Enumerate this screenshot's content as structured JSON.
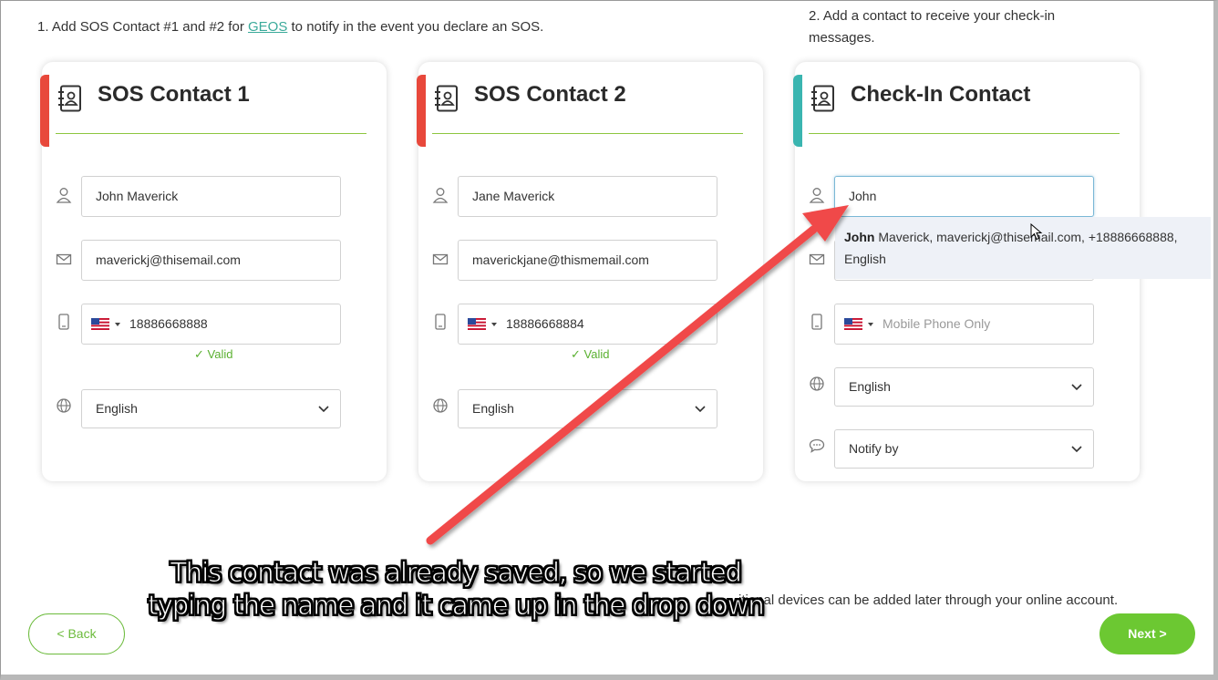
{
  "step1": {
    "before": "1. Add SOS Contact #1 and #2 for ",
    "link": "GEOS",
    "after": " to notify in the event you declare an SOS."
  },
  "step2": {
    "text": "2. Add a contact to receive your check-in messages."
  },
  "colors": {
    "sos_accent": "#e8483b",
    "checkin_accent": "#3ab5b0",
    "rule": "#8dc63f",
    "brand_green": "#6cc832",
    "valid": "#5ab030"
  },
  "sos1": {
    "title": "SOS Contact 1",
    "name": "John Maverick",
    "email": "maverickj@thisemail.com",
    "phone": "18886668888",
    "valid": "✓ Valid",
    "language": "English"
  },
  "sos2": {
    "title": "SOS Contact 2",
    "name": "Jane Maverick",
    "email": "maverickjane@thismemail.com",
    "phone": "18886668884",
    "valid": "✓ Valid",
    "language": "English"
  },
  "checkin": {
    "title": "Check-In Contact",
    "name": "John",
    "phone_placeholder": "Mobile Phone Only",
    "language": "English",
    "notify": "Notify by"
  },
  "suggestion": {
    "match": "John",
    "rest": " Maverick, maverickj@thisemail.com, +18886668888,",
    "line2": "English"
  },
  "footer": {
    "text": "itional devices can be added later through your online account."
  },
  "buttons": {
    "back": "< Back",
    "next": "Next >"
  },
  "annotation": {
    "line1": "This contact was already saved, so we started",
    "line2": "typing the name and it came up in the drop down"
  },
  "icons": [
    "address-book-icon",
    "person-icon",
    "envelope-icon",
    "mobile-phone-icon",
    "globe-icon",
    "chat-bubble-icon",
    "us-flag-icon",
    "chevron-down-icon",
    "mouse-cursor-icon",
    "red-arrow"
  ]
}
